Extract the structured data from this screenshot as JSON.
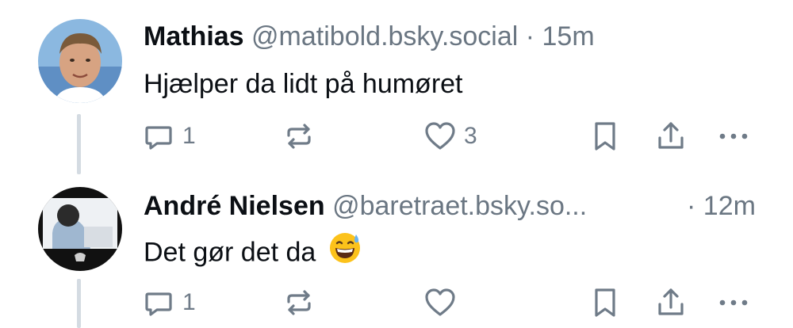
{
  "posts": [
    {
      "name": "Mathias",
      "handle": "@matibold.bsky.social",
      "separator": "·",
      "time": "15m",
      "text": "Hjælper da lidt på humøret",
      "reply_count": "1",
      "repost_count": "",
      "like_count": "3"
    },
    {
      "name": "André Nielsen",
      "handle": "@baretraet.bsky.so...",
      "separator": "·",
      "time": "12m",
      "text": "Det gør det da",
      "emoji": "grinning-face-with-sweat",
      "reply_count": "1",
      "repost_count": "",
      "like_count": ""
    }
  ],
  "colors": {
    "text": "#0b0f14",
    "muted": "#6a7682",
    "icon": "#6f7b88",
    "thread_line": "#d4dbe2"
  }
}
